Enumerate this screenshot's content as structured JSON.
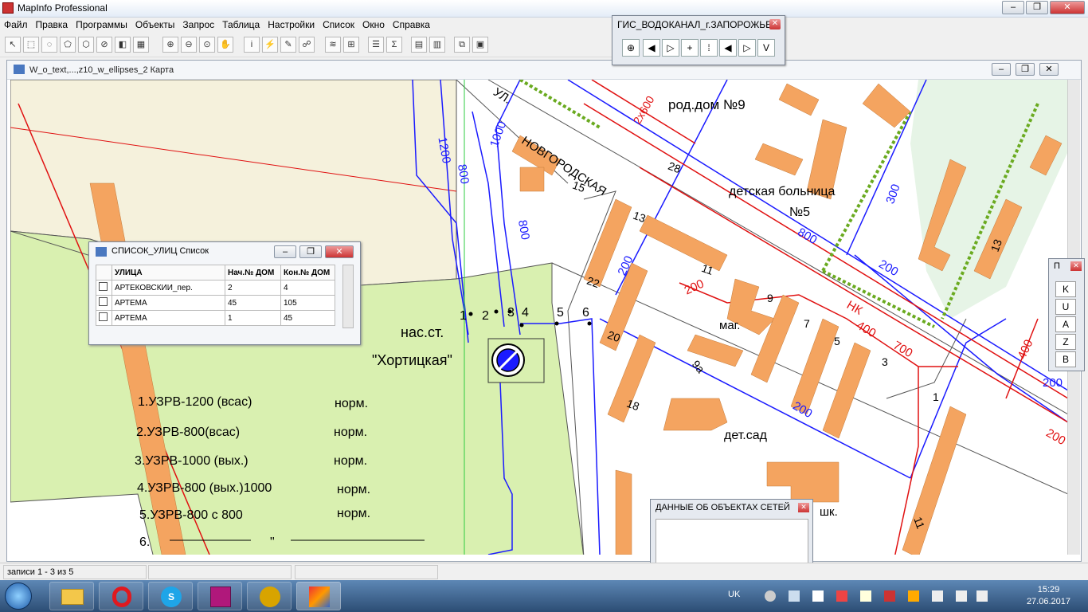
{
  "app": {
    "title": "MapInfo Professional"
  },
  "menu": [
    "Файл",
    "Правка",
    "Программы",
    "Объекты",
    "Запрос",
    "Таблица",
    "Настройки",
    "Список",
    "Окно",
    "Справка"
  ],
  "gis_toolbar": {
    "title": "ГИС_ВОДОКАНАЛ_г.ЗАПОРОЖЬЕ",
    "buttons": [
      "⊕",
      "◀",
      "▷",
      "+",
      "⁞",
      "◀",
      "▷",
      "V"
    ]
  },
  "map_window": {
    "title": "W_o_text,...,z10_w_ellipses_2 Карта"
  },
  "map_labels": {
    "street1": "УЛ.",
    "street2": "НОВГОРОДСКАЯ",
    "roddom": "род.дом №9",
    "hospital1": "детская больница",
    "hospital2": "№5",
    "station1": "нас.ст.",
    "station2": "\"Хортицкая\"",
    "mag": "маг.",
    "detsad": "дет.сад",
    "shk": "шк.",
    "pipe_1200": "1200",
    "pipe_800a": "800",
    "pipe_1000": "1000",
    "pipe_800b": "800",
    "pipe_2x600": "2x600",
    "pipe_300": "300",
    "pipe_800c": "800",
    "pipe_200a": "200",
    "pipe_200b": "200",
    "pipe_200c": "200",
    "pipe_200red": "200",
    "pipe_400": "400",
    "pipe_700": "700",
    "pipe_nk": "НК",
    "pipe_400b": "400",
    "pipe_200d": "200",
    "pipe_200e": "200",
    "h15": "15",
    "h28": "28",
    "h13a": "13",
    "h11": "11",
    "h22": "22",
    "h20": "20",
    "h18": "18",
    "h9": "9",
    "h9a": "9а",
    "h7": "7",
    "h5": "5",
    "h3": "3",
    "h1": "1",
    "h13b": "13",
    "h11b": "11",
    "valve1": "1",
    "valve2": "2",
    "valve3": "3",
    "valve4": "4",
    "valve5": "5",
    "valve6": "6"
  },
  "legend": [
    {
      "label": "1.УЗРВ-1200 (всас)",
      "status": "норм."
    },
    {
      "label": "2.УЗРВ-800(всас)",
      "status": "норм."
    },
    {
      "label": "3.УЗРВ-1000 (вых.)",
      "status": "норм."
    },
    {
      "label": "4.УЗРВ-800 (вых.)1000",
      "status": "норм."
    },
    {
      "label": "5.УЗРВ-800 с 800",
      "status": "норм."
    },
    {
      "label": "6.",
      "status": "\""
    }
  ],
  "list_window": {
    "title": "СПИСОК_УЛИЦ Список",
    "columns": [
      "УЛИЦА",
      "Нач.№ ДОМ",
      "Кон.№ ДОМ"
    ],
    "rows": [
      [
        "АРТЕКОВСКИИ_пер.",
        "2",
        "4"
      ],
      [
        "АРТЕМА",
        "45",
        "105"
      ],
      [
        "АРТЕМА",
        "1",
        "45"
      ]
    ]
  },
  "side_panel": {
    "title": "П",
    "buttons": [
      "K",
      "U",
      "A",
      "Z",
      "B"
    ]
  },
  "data_panel": {
    "title": "ДАННЫЕ ОБ ОБЪЕКТАХ СЕТЕЙ"
  },
  "status": {
    "records": "записи 1 - 3 из 5"
  },
  "taskbar": {
    "lang": "UK",
    "time": "15:29",
    "date": "27.06.2017"
  },
  "colors": {
    "building": "#f4a460",
    "greenzone": "#d9f0b0",
    "park": "#e6f4e6",
    "sand": "#f5f1dc",
    "pipe_blue": "#1a1aff",
    "pipe_red": "#e01010",
    "green_line": "#6aaa20"
  }
}
